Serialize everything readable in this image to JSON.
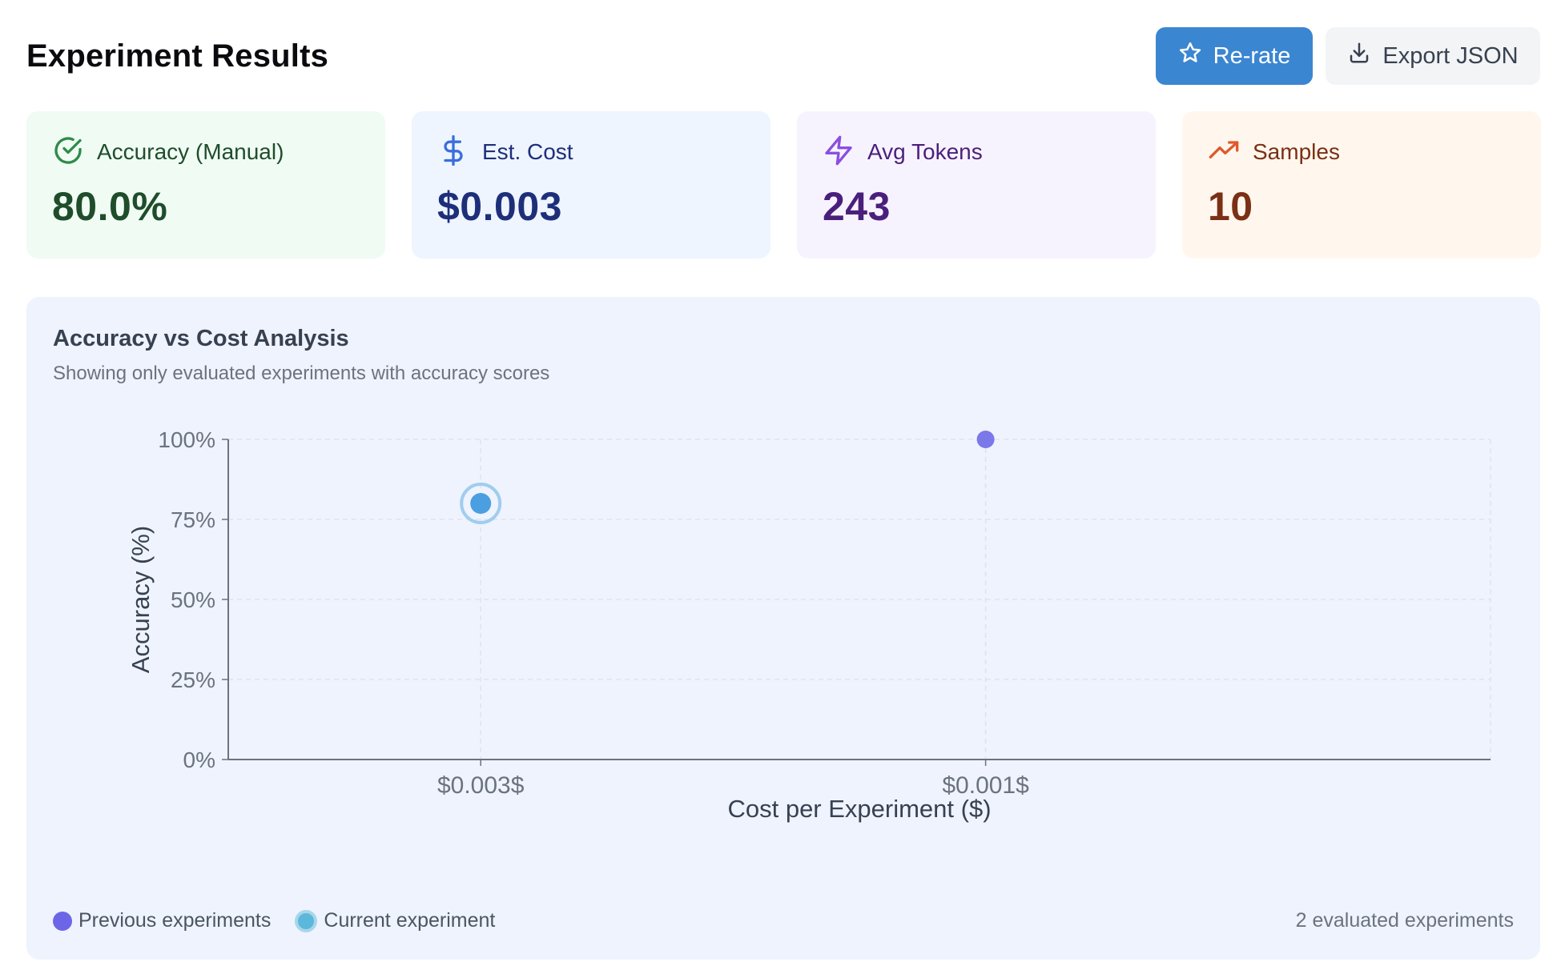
{
  "header": {
    "title": "Experiment Results",
    "rerate_label": "Re-rate",
    "export_label": "Export JSON"
  },
  "cards": [
    {
      "label": "Accuracy (Manual)",
      "value": "80.0%",
      "icon": "check-circle-icon",
      "color": "#2f8a4a"
    },
    {
      "label": "Est. Cost",
      "value": "$0.003",
      "icon": "dollar-icon",
      "color": "#3b6fd9"
    },
    {
      "label": "Avg Tokens",
      "value": "243",
      "icon": "lightning-icon",
      "color": "#8a4fe0"
    },
    {
      "label": "Samples",
      "value": "10",
      "icon": "trending-up-icon",
      "color": "#e05a2a"
    }
  ],
  "chart_panel": {
    "title": "Accuracy vs Cost Analysis",
    "subtitle": "Showing only evaluated experiments with accuracy scores",
    "legend": {
      "previous": "Previous experiments",
      "current": "Current experiment"
    },
    "count_text": "2 evaluated experiments"
  },
  "chart_data": {
    "type": "scatter",
    "xlabel": "Cost per Experiment ($)",
    "ylabel": "Accuracy (%)",
    "x_tick_labels": [
      "$0.003$",
      "$0.001$"
    ],
    "y_ticks": [
      0,
      25,
      50,
      75,
      100
    ],
    "y_tick_labels": [
      "0%",
      "25%",
      "50%",
      "75%",
      "100%"
    ],
    "ylim": [
      0,
      100
    ],
    "grid": true,
    "legend_position": "bottom-left",
    "series": [
      {
        "name": "Previous experiments",
        "color": "#7b78ea",
        "points": [
          {
            "x": "$0.001$",
            "y": 100
          }
        ]
      },
      {
        "name": "Current experiment",
        "color": "#4a9fe0",
        "points": [
          {
            "x": "$0.003$",
            "y": 80
          }
        ]
      }
    ]
  }
}
